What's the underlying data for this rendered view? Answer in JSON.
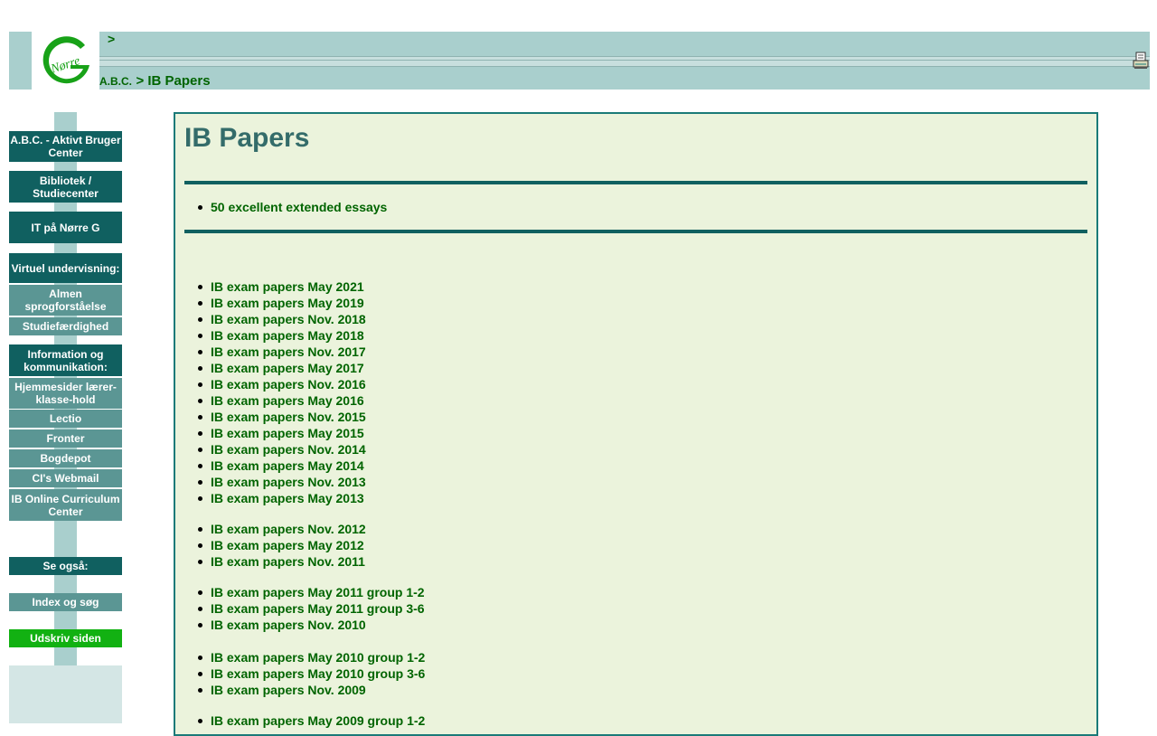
{
  "header": {
    "crumb_top": ">",
    "crumb_a": "A.B.C.",
    "crumb_b": "> IB Papers"
  },
  "sidebar": {
    "abc": "A.B.C. - Aktivt Bruger Center",
    "bibliotek": "Bibliotek / Studiecenter",
    "it": "IT på Nørre G",
    "virtuel": "Virtuel undervisning:",
    "almen": "Almen sprogforståelse",
    "studie": "Studiefærdighed",
    "info": "Information og kommunikation:",
    "hjemmesider": "Hjemmesider lærer-klasse-hold",
    "lectio": "Lectio",
    "fronter": "Fronter",
    "bogdepot": "Bogdepot",
    "webmail": "CI's Webmail",
    "ibocc": "IB Online Curriculum Center",
    "se_ogsaa": "Se også:",
    "index": "Index og søg",
    "udskriv": "Udskriv siden"
  },
  "content": {
    "title": "IB Papers",
    "essays": "50 excellent extended essays",
    "group1": [
      "IB exam papers May 2021",
      "IB exam papers May 2019",
      "IB exam papers Nov. 2018",
      "IB exam papers May 2018",
      "IB exam papers Nov. 2017",
      "IB exam papers May 2017",
      "IB exam papers Nov. 2016",
      "IB exam papers May 2016",
      "IB exam papers Nov. 2015",
      "IB exam papers May 2015",
      "IB exam papers Nov. 2014",
      "IB exam papers May 2014",
      "IB exam papers Nov. 2013",
      "IB exam papers May 2013"
    ],
    "group2": [
      "IB exam papers Nov. 2012",
      "IB exam papers May 2012",
      "IB exam papers Nov. 2011"
    ],
    "group3": [
      "IB exam papers May 2011 group 1-2",
      "IB exam papers May 2011 group 3-6",
      "IB exam papers Nov. 2010"
    ],
    "group4": [
      "IB exam papers May 2010 group 1-2",
      "IB exam papers May 2010 group 3-6",
      "IB exam papers Nov. 2009"
    ],
    "group5": [
      "IB exam papers May 2009 group 1-2"
    ]
  },
  "colors": {
    "accent": "#106060",
    "link": "#006400",
    "panel": "#ebf3dc"
  },
  "icons": [
    "norre-g-logo-icon",
    "printer-icon"
  ]
}
